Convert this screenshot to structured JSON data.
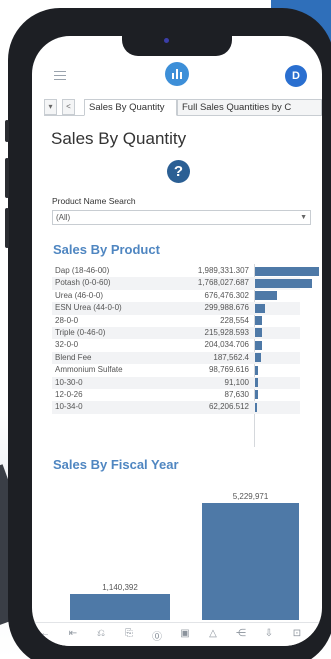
{
  "header": {
    "menu_icon": "hamburger-icon",
    "logo_icon": "bar-chart-logo-icon",
    "avatar_initial": "D",
    "accent": "#2a6fd0"
  },
  "tabs": {
    "nav_prev": "▾",
    "nav_back": "<",
    "items": [
      {
        "label": "Sales By Quantity",
        "active": true
      },
      {
        "label": "Full Sales Quantities by C",
        "active": false
      }
    ]
  },
  "page": {
    "title": "Sales By Quantity",
    "help_glyph": "?"
  },
  "filter": {
    "label": "Product Name Search",
    "value": "(All)"
  },
  "sales_by_product": {
    "title": "Sales By Product",
    "bar_color": "#4e79a7",
    "rows": [
      {
        "name": "Dap (18-46-00)",
        "value": "1,989,331.307",
        "num": 1989331.307
      },
      {
        "name": "Potash (0-0-60)",
        "value": "1,768,027.687",
        "num": 1768027.687
      },
      {
        "name": "Urea (46-0-0)",
        "value": "676,476.302",
        "num": 676476.302
      },
      {
        "name": "ESN Urea (44-0-0)",
        "value": "299,988.676",
        "num": 299988.676
      },
      {
        "name": "28-0-0",
        "value": "228,554",
        "num": 228554
      },
      {
        "name": "Triple (0-46-0)",
        "value": "215,928.593",
        "num": 215928.593
      },
      {
        "name": "32-0-0",
        "value": "204,034.706",
        "num": 204034.706
      },
      {
        "name": "Blend Fee",
        "value": "187,562.4",
        "num": 187562.4
      },
      {
        "name": "Ammonium Sulfate",
        "value": "98,769.616",
        "num": 98769.616
      },
      {
        "name": "10-30-0",
        "value": "91,100",
        "num": 91100
      },
      {
        "name": "12-0-26",
        "value": "87,630",
        "num": 87630
      },
      {
        "name": "10-34-0",
        "value": "62,206.512",
        "num": 62206.512
      }
    ]
  },
  "sales_by_fiscal_year": {
    "title": "Sales By Fiscal Year",
    "bars": [
      {
        "label": "1,140,392",
        "value": 1140392
      },
      {
        "label": "5,229,971",
        "value": 5229971
      }
    ]
  },
  "bottom_bar": {
    "icons": [
      "undo-icon",
      "revert-icon",
      "redo-icon",
      "pause-icon",
      "refresh-icon",
      "comment-icon",
      "metrics-icon",
      "alert-icon",
      "share-icon",
      "download-icon"
    ]
  },
  "chart_data": [
    {
      "type": "bar",
      "title": "Sales By Product",
      "categories": [
        "Dap (18-46-00)",
        "Potash (0-0-60)",
        "Urea (46-0-0)",
        "ESN Urea (44-0-0)",
        "28-0-0",
        "Triple (0-46-0)",
        "32-0-0",
        "Blend Fee",
        "Ammonium Sulfate",
        "10-30-0",
        "12-0-26",
        "10-34-0"
      ],
      "values": [
        1989331.307,
        1768027.687,
        676476.302,
        299988.676,
        228554,
        215928.593,
        204034.706,
        187562.4,
        98769.616,
        91100,
        87630,
        62206.512
      ],
      "orientation": "horizontal"
    },
    {
      "type": "bar",
      "title": "Sales By Fiscal Year",
      "categories": [
        "",
        ""
      ],
      "values": [
        1140392,
        5229971
      ]
    }
  ]
}
